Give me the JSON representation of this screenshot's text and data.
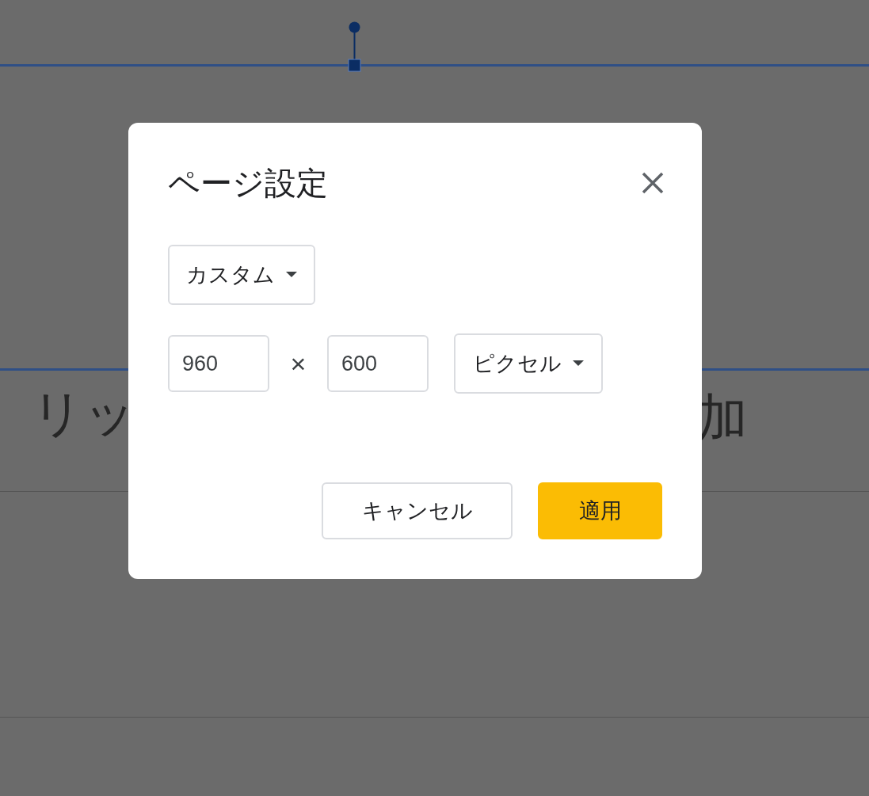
{
  "slide": {
    "title_fragments": [
      "リッ",
      "加"
    ]
  },
  "dialog": {
    "title": "ページ設定",
    "preset": {
      "value": "カスタム"
    },
    "width": {
      "value": "960"
    },
    "separator": "×",
    "height": {
      "value": "600"
    },
    "unit": {
      "value": "ピクセル"
    },
    "buttons": [
      {
        "label": "キャンセル",
        "kind": "secondary"
      },
      {
        "label": "適用",
        "kind": "primary"
      }
    ]
  }
}
